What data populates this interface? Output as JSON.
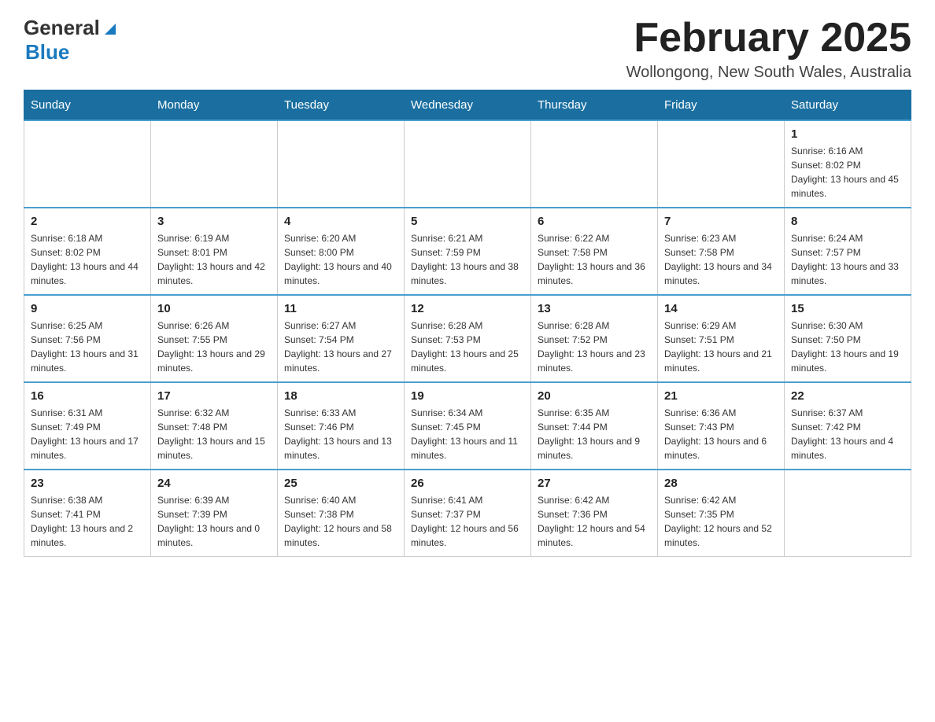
{
  "header": {
    "logo_general": "General",
    "logo_blue": "Blue",
    "title": "February 2025",
    "subtitle": "Wollongong, New South Wales, Australia"
  },
  "days_of_week": [
    "Sunday",
    "Monday",
    "Tuesday",
    "Wednesday",
    "Thursday",
    "Friday",
    "Saturday"
  ],
  "weeks": [
    {
      "days": [
        {
          "number": "",
          "sunrise": "",
          "sunset": "",
          "daylight": "",
          "empty": true
        },
        {
          "number": "",
          "sunrise": "",
          "sunset": "",
          "daylight": "",
          "empty": true
        },
        {
          "number": "",
          "sunrise": "",
          "sunset": "",
          "daylight": "",
          "empty": true
        },
        {
          "number": "",
          "sunrise": "",
          "sunset": "",
          "daylight": "",
          "empty": true
        },
        {
          "number": "",
          "sunrise": "",
          "sunset": "",
          "daylight": "",
          "empty": true
        },
        {
          "number": "",
          "sunrise": "",
          "sunset": "",
          "daylight": "",
          "empty": true
        },
        {
          "number": "1",
          "sunrise": "Sunrise: 6:16 AM",
          "sunset": "Sunset: 8:02 PM",
          "daylight": "Daylight: 13 hours and 45 minutes.",
          "empty": false
        }
      ]
    },
    {
      "days": [
        {
          "number": "2",
          "sunrise": "Sunrise: 6:18 AM",
          "sunset": "Sunset: 8:02 PM",
          "daylight": "Daylight: 13 hours and 44 minutes.",
          "empty": false
        },
        {
          "number": "3",
          "sunrise": "Sunrise: 6:19 AM",
          "sunset": "Sunset: 8:01 PM",
          "daylight": "Daylight: 13 hours and 42 minutes.",
          "empty": false
        },
        {
          "number": "4",
          "sunrise": "Sunrise: 6:20 AM",
          "sunset": "Sunset: 8:00 PM",
          "daylight": "Daylight: 13 hours and 40 minutes.",
          "empty": false
        },
        {
          "number": "5",
          "sunrise": "Sunrise: 6:21 AM",
          "sunset": "Sunset: 7:59 PM",
          "daylight": "Daylight: 13 hours and 38 minutes.",
          "empty": false
        },
        {
          "number": "6",
          "sunrise": "Sunrise: 6:22 AM",
          "sunset": "Sunset: 7:58 PM",
          "daylight": "Daylight: 13 hours and 36 minutes.",
          "empty": false
        },
        {
          "number": "7",
          "sunrise": "Sunrise: 6:23 AM",
          "sunset": "Sunset: 7:58 PM",
          "daylight": "Daylight: 13 hours and 34 minutes.",
          "empty": false
        },
        {
          "number": "8",
          "sunrise": "Sunrise: 6:24 AM",
          "sunset": "Sunset: 7:57 PM",
          "daylight": "Daylight: 13 hours and 33 minutes.",
          "empty": false
        }
      ]
    },
    {
      "days": [
        {
          "number": "9",
          "sunrise": "Sunrise: 6:25 AM",
          "sunset": "Sunset: 7:56 PM",
          "daylight": "Daylight: 13 hours and 31 minutes.",
          "empty": false
        },
        {
          "number": "10",
          "sunrise": "Sunrise: 6:26 AM",
          "sunset": "Sunset: 7:55 PM",
          "daylight": "Daylight: 13 hours and 29 minutes.",
          "empty": false
        },
        {
          "number": "11",
          "sunrise": "Sunrise: 6:27 AM",
          "sunset": "Sunset: 7:54 PM",
          "daylight": "Daylight: 13 hours and 27 minutes.",
          "empty": false
        },
        {
          "number": "12",
          "sunrise": "Sunrise: 6:28 AM",
          "sunset": "Sunset: 7:53 PM",
          "daylight": "Daylight: 13 hours and 25 minutes.",
          "empty": false
        },
        {
          "number": "13",
          "sunrise": "Sunrise: 6:28 AM",
          "sunset": "Sunset: 7:52 PM",
          "daylight": "Daylight: 13 hours and 23 minutes.",
          "empty": false
        },
        {
          "number": "14",
          "sunrise": "Sunrise: 6:29 AM",
          "sunset": "Sunset: 7:51 PM",
          "daylight": "Daylight: 13 hours and 21 minutes.",
          "empty": false
        },
        {
          "number": "15",
          "sunrise": "Sunrise: 6:30 AM",
          "sunset": "Sunset: 7:50 PM",
          "daylight": "Daylight: 13 hours and 19 minutes.",
          "empty": false
        }
      ]
    },
    {
      "days": [
        {
          "number": "16",
          "sunrise": "Sunrise: 6:31 AM",
          "sunset": "Sunset: 7:49 PM",
          "daylight": "Daylight: 13 hours and 17 minutes.",
          "empty": false
        },
        {
          "number": "17",
          "sunrise": "Sunrise: 6:32 AM",
          "sunset": "Sunset: 7:48 PM",
          "daylight": "Daylight: 13 hours and 15 minutes.",
          "empty": false
        },
        {
          "number": "18",
          "sunrise": "Sunrise: 6:33 AM",
          "sunset": "Sunset: 7:46 PM",
          "daylight": "Daylight: 13 hours and 13 minutes.",
          "empty": false
        },
        {
          "number": "19",
          "sunrise": "Sunrise: 6:34 AM",
          "sunset": "Sunset: 7:45 PM",
          "daylight": "Daylight: 13 hours and 11 minutes.",
          "empty": false
        },
        {
          "number": "20",
          "sunrise": "Sunrise: 6:35 AM",
          "sunset": "Sunset: 7:44 PM",
          "daylight": "Daylight: 13 hours and 9 minutes.",
          "empty": false
        },
        {
          "number": "21",
          "sunrise": "Sunrise: 6:36 AM",
          "sunset": "Sunset: 7:43 PM",
          "daylight": "Daylight: 13 hours and 6 minutes.",
          "empty": false
        },
        {
          "number": "22",
          "sunrise": "Sunrise: 6:37 AM",
          "sunset": "Sunset: 7:42 PM",
          "daylight": "Daylight: 13 hours and 4 minutes.",
          "empty": false
        }
      ]
    },
    {
      "days": [
        {
          "number": "23",
          "sunrise": "Sunrise: 6:38 AM",
          "sunset": "Sunset: 7:41 PM",
          "daylight": "Daylight: 13 hours and 2 minutes.",
          "empty": false
        },
        {
          "number": "24",
          "sunrise": "Sunrise: 6:39 AM",
          "sunset": "Sunset: 7:39 PM",
          "daylight": "Daylight: 13 hours and 0 minutes.",
          "empty": false
        },
        {
          "number": "25",
          "sunrise": "Sunrise: 6:40 AM",
          "sunset": "Sunset: 7:38 PM",
          "daylight": "Daylight: 12 hours and 58 minutes.",
          "empty": false
        },
        {
          "number": "26",
          "sunrise": "Sunrise: 6:41 AM",
          "sunset": "Sunset: 7:37 PM",
          "daylight": "Daylight: 12 hours and 56 minutes.",
          "empty": false
        },
        {
          "number": "27",
          "sunrise": "Sunrise: 6:42 AM",
          "sunset": "Sunset: 7:36 PM",
          "daylight": "Daylight: 12 hours and 54 minutes.",
          "empty": false
        },
        {
          "number": "28",
          "sunrise": "Sunrise: 6:42 AM",
          "sunset": "Sunset: 7:35 PM",
          "daylight": "Daylight: 12 hours and 52 minutes.",
          "empty": false
        },
        {
          "number": "",
          "sunrise": "",
          "sunset": "",
          "daylight": "",
          "empty": true
        }
      ]
    }
  ]
}
